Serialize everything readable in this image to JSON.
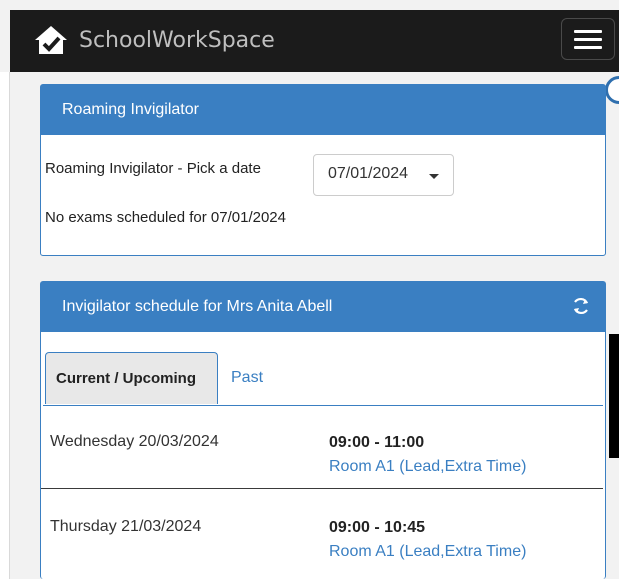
{
  "app": {
    "name": "SchoolWorkSpace"
  },
  "roaming": {
    "title": "Roaming Invigilator",
    "pick_label": "Roaming Invigilator - Pick a date",
    "selected_date": "07/01/2024",
    "empty_message": "No exams scheduled for 07/01/2024"
  },
  "schedule": {
    "title": "Invigilator schedule for Mrs Anita Abell",
    "tabs": [
      {
        "label": "Current / Upcoming",
        "active": true
      },
      {
        "label": "Past",
        "active": false
      }
    ],
    "rows": [
      {
        "day": "Wednesday 20/03/2024",
        "time": "09:00 - 11:00",
        "room": "Room A1 (Lead,Extra Time)"
      },
      {
        "day": "Thursday 21/03/2024",
        "time": "09:00 - 10:45",
        "room": "Room A1 (Lead,Extra Time)"
      }
    ]
  },
  "icons": {
    "logo": "house-check-icon",
    "menu": "hamburger-icon",
    "refresh": "refresh-icon",
    "caret": "caret-down-icon"
  },
  "colors": {
    "accent": "#3a7fc2",
    "topbar": "#1b1b1b"
  }
}
